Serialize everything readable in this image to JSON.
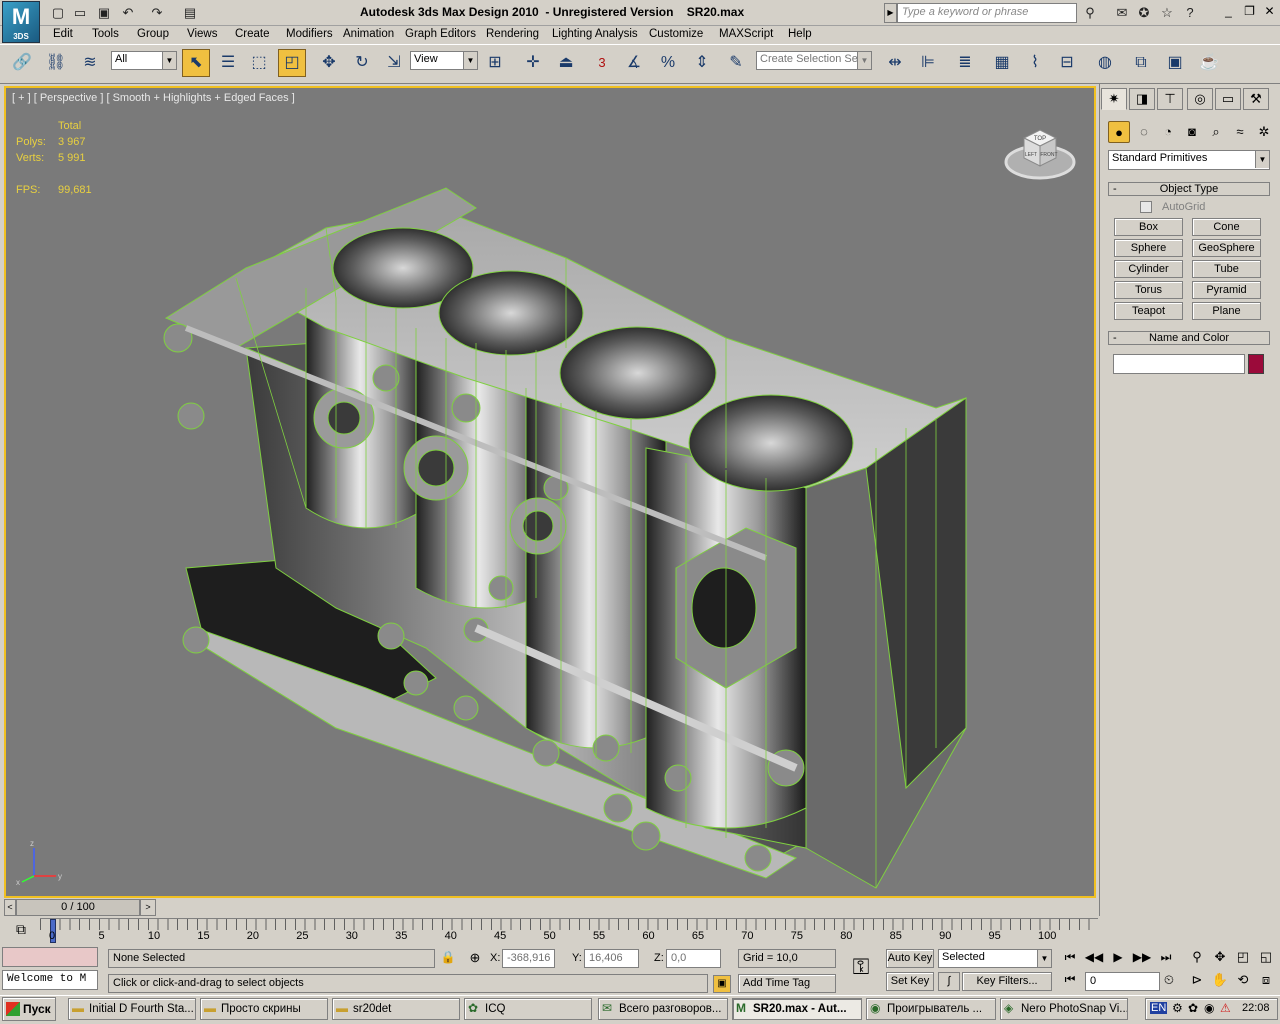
{
  "app": {
    "title": "Autodesk 3ds Max Design 2010  - Unregistered Version    SR20.max",
    "logo": "3DS",
    "search_placeholder": "Type a keyword or phrase"
  },
  "menu": [
    "Edit",
    "Tools",
    "Group",
    "Views",
    "Create",
    "Modifiers",
    "Animation",
    "Graph Editors",
    "Rendering",
    "Lighting Analysis",
    "Customize",
    "MAXScript",
    "Help"
  ],
  "toolbar": {
    "filter": "All",
    "ref_coord": "View",
    "snap_angle": "3",
    "selection_set_placeholder": "Create Selection Se"
  },
  "viewport": {
    "label": "[ + ] [ Perspective ] [ Smooth + Highlights + Edged Faces ]",
    "stats": {
      "total_label": "Total",
      "polys_label": "Polys:",
      "polys": "3 967",
      "verts_label": "Verts:",
      "verts": "5 991",
      "fps_label": "FPS:",
      "fps": "99,681"
    },
    "viewcube": {
      "top": "TOP",
      "left": "LEFT",
      "front": "FRONT"
    },
    "axes": {
      "x": "x",
      "y": "y",
      "z": "z"
    }
  },
  "command_panel": {
    "category": "Standard Primitives",
    "object_type_title": "Object Type",
    "autogrid": "AutoGrid",
    "autogrid_checked": false,
    "buttons": [
      "Box",
      "Cone",
      "Sphere",
      "GeoSphere",
      "Cylinder",
      "Tube",
      "Torus",
      "Pyramid",
      "Teapot",
      "Plane"
    ],
    "name_color_title": "Name and Color",
    "name_value": "",
    "object_color": "#9b0a3a"
  },
  "timeline": {
    "frame": "0 / 100",
    "ticks": [
      "0",
      "5",
      "10",
      "15",
      "20",
      "25",
      "30",
      "35",
      "40",
      "45",
      "50",
      "55",
      "60",
      "65",
      "70",
      "75",
      "80",
      "85",
      "90",
      "95",
      "100"
    ]
  },
  "status": {
    "maxscript": "Welcome to M",
    "selection": "None Selected",
    "prompt": "Click or click-and-drag to select objects",
    "x_label": "X:",
    "x": "-368,916",
    "y_label": "Y:",
    "y": "16,406",
    "z_label": "Z:",
    "z": "0,0",
    "grid": "Grid = 10,0",
    "add_time_tag": "Add Time Tag",
    "auto_key": "Auto Key",
    "set_key": "Set Key",
    "key_mode": "Selected",
    "key_filters": "Key Filters...",
    "frame_field": "0"
  },
  "taskbar": {
    "start": "Пуск",
    "tasks": [
      {
        "label": "Initial D Fourth Sta...",
        "icon": "folder-icon"
      },
      {
        "label": "Просто скрины",
        "icon": "folder-icon"
      },
      {
        "label": "sr20det",
        "icon": "folder-icon"
      },
      {
        "label": "ICQ",
        "icon": "icq-icon"
      },
      {
        "label": "Всего разговоров...",
        "icon": "chat-icon"
      },
      {
        "label": "SR20.max - Aut...",
        "icon": "max-icon",
        "active": true
      },
      {
        "label": "Проигрыватель ...",
        "icon": "player-icon"
      },
      {
        "label": "Nero PhotoSnap Vi...",
        "icon": "nero-icon"
      }
    ],
    "lang": "EN",
    "clock": "22:08"
  }
}
